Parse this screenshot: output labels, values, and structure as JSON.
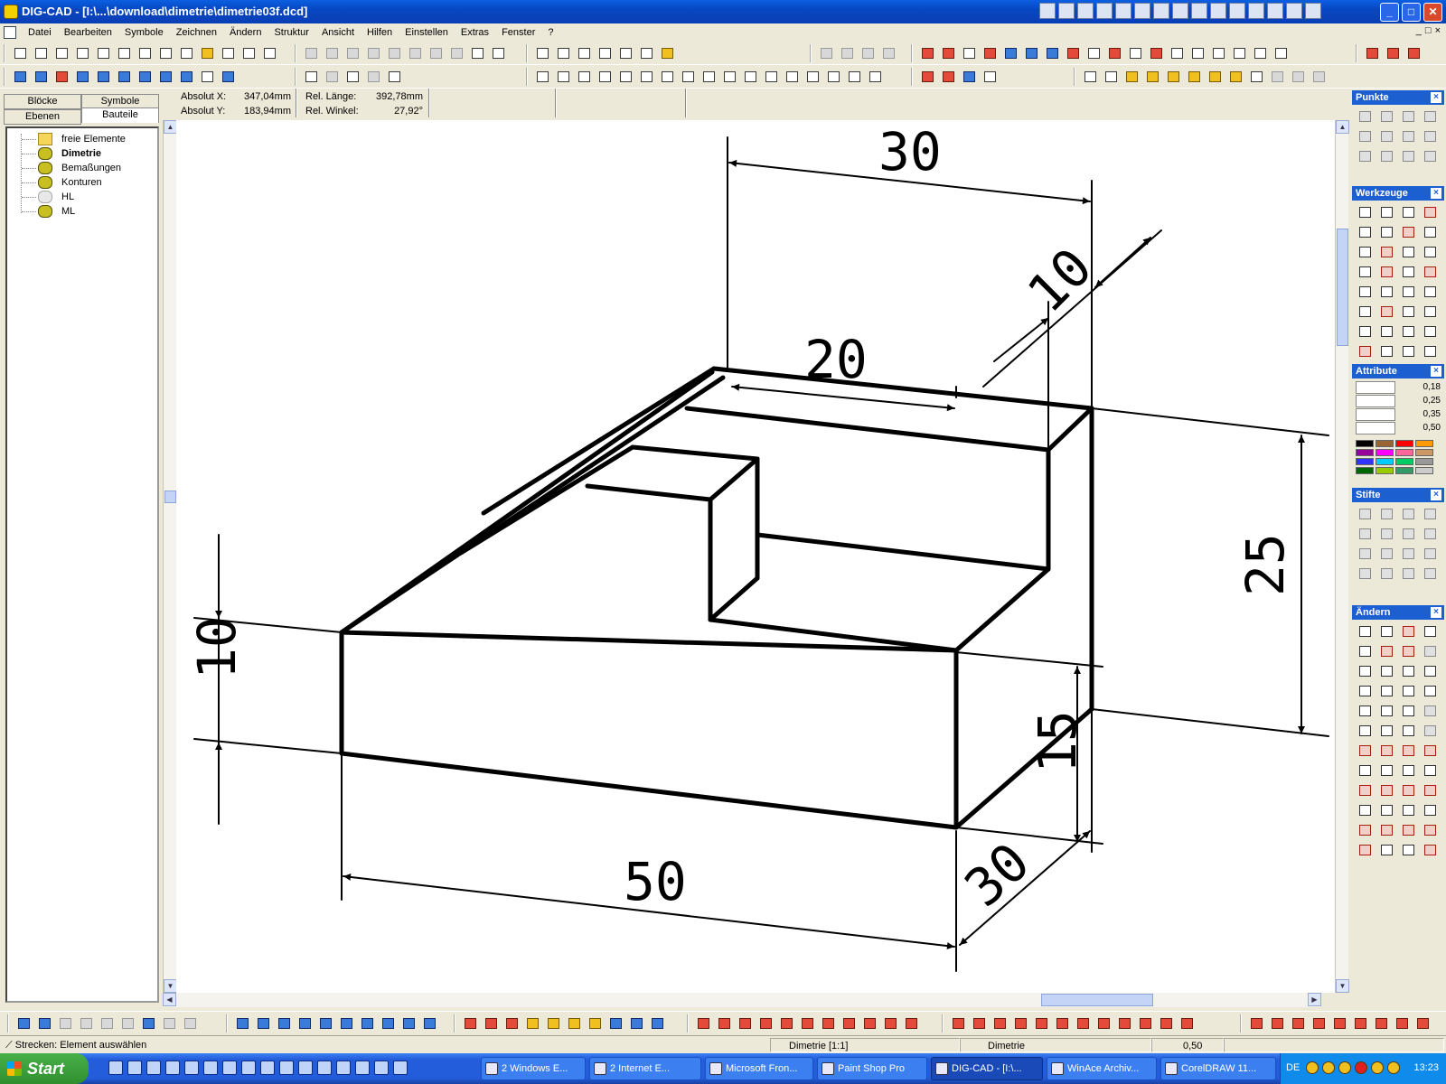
{
  "window": {
    "title": "DIG-CAD - [I:\\...\\download\\dimetrie\\dimetrie03f.dcd]",
    "minimize": "_",
    "maximize": "□",
    "close": "✕"
  },
  "menu": [
    "Datei",
    "Bearbeiten",
    "Symbole",
    "Zeichnen",
    "Ändern",
    "Struktur",
    "Ansicht",
    "Hilfen",
    "Einstellen",
    "Extras",
    "Fenster",
    "?"
  ],
  "mdi_buttons": [
    "_",
    "□",
    "×"
  ],
  "left_panel": {
    "tabs": [
      "Blöcke",
      "Symbole",
      "Ebenen",
      "Bauteile"
    ],
    "active_tab": "Bauteile",
    "tree": [
      {
        "label": "freie Elemente",
        "icon": "folder-icon",
        "bold": false
      },
      {
        "label": "Dimetrie",
        "icon": "layer-icon",
        "bold": true
      },
      {
        "label": "Bemaßungen",
        "icon": "layer-icon",
        "bold": false
      },
      {
        "label": "Konturen",
        "icon": "layer-icon",
        "bold": false
      },
      {
        "label": "HL",
        "icon": "layer-icon-dimmed",
        "bold": false
      },
      {
        "label": "ML",
        "icon": "layer-icon",
        "bold": false
      }
    ]
  },
  "coords": {
    "abs_x_label": "Absolut X:",
    "abs_x_value": "347,04mm",
    "abs_y_label": "Absolut Y:",
    "abs_y_value": "183,94mm",
    "rel_len_label": "Rel. Länge:",
    "rel_len_value": "392,78mm",
    "rel_ang_label": "Rel. Winkel:",
    "rel_ang_value": "27,92°"
  },
  "drawing": {
    "dim_top": "30",
    "dim_depth_top": "10",
    "dim_inner": "20",
    "dim_height": "25",
    "dim_left": "10",
    "dim_front_height": "15",
    "dim_depth_bottom": "30",
    "dim_length": "50"
  },
  "right_panel": {
    "palettes": [
      {
        "title": "Punkte"
      },
      {
        "title": "Werkzeuge"
      },
      {
        "title": "Attribute"
      },
      {
        "title": "Stifte"
      },
      {
        "title": "Ändern"
      }
    ],
    "line_widths": [
      "0,18",
      "0,25",
      "0,35",
      "0,50"
    ],
    "colors": [
      "#000000",
      "#996633",
      "#FF0000",
      "#FF9900",
      "#990099",
      "#FF00FF",
      "#FF6699",
      "#CC9966",
      "#3333FF",
      "#00CCFF",
      "#00CC66",
      "#999999",
      "#006600",
      "#99CC00",
      "#339966",
      "#CCCCCC"
    ]
  },
  "status": {
    "hint": "Strecken: Element auswählen",
    "view": "Dimetrie [1:1]",
    "layer": "Dimetrie",
    "pen": "0,50"
  },
  "taskbar": {
    "start": "Start",
    "tasks": [
      {
        "label": "2 Windows E...",
        "active": false
      },
      {
        "label": "2 Internet E...",
        "active": false
      },
      {
        "label": "Microsoft Fron...",
        "active": false
      },
      {
        "label": "Paint Shop Pro",
        "active": false
      },
      {
        "label": "DIG-CAD - [I:\\...",
        "active": true
      },
      {
        "label": "WinAce Archiv...",
        "active": false
      },
      {
        "label": "CorelDRAW 11...",
        "active": false
      }
    ],
    "lang": "DE",
    "clock": "13:23"
  }
}
